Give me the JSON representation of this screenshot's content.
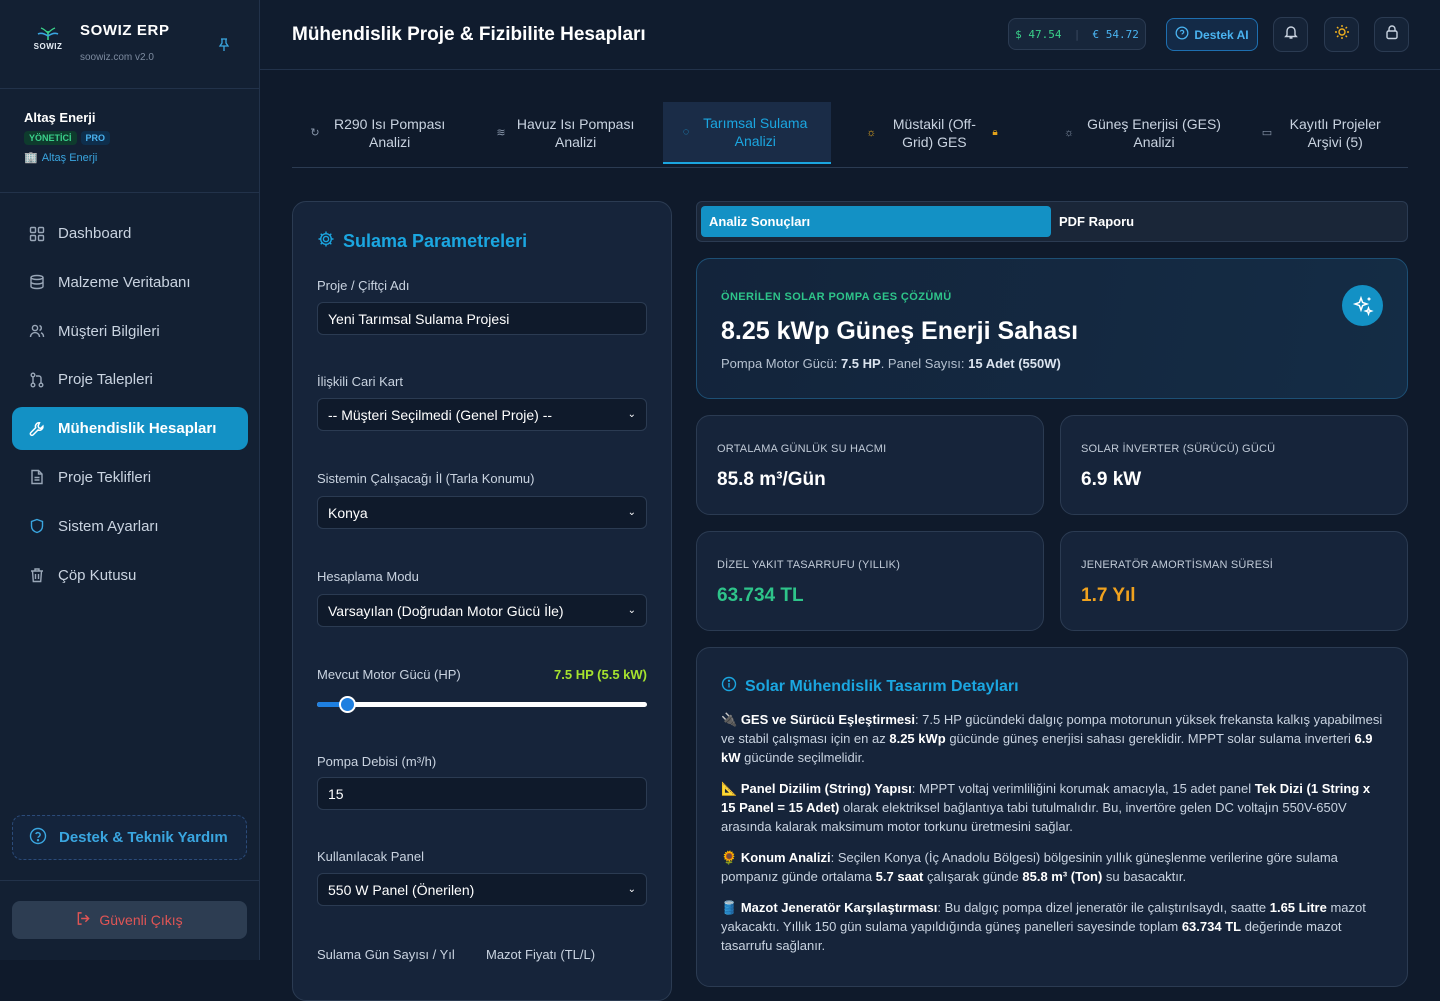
{
  "brand": {
    "title": "SOWIZ ERP",
    "subtitle": "soowiz.com v2.0",
    "logo_text": "SOWIZ"
  },
  "user": {
    "name": "Altaş Enerji",
    "badge_role": "YÖNETİCİ",
    "badge_plan": "PRO",
    "company": "Altaş Enerji"
  },
  "nav": [
    {
      "label": "Dashboard",
      "icon": "grid-icon",
      "active": false
    },
    {
      "label": "Malzeme Veritabanı",
      "icon": "database-icon",
      "active": false
    },
    {
      "label": "Müşteri Bilgileri",
      "icon": "users-icon",
      "active": false
    },
    {
      "label": "Proje Talepleri",
      "icon": "git-pull-icon",
      "active": false
    },
    {
      "label": "Mühendislik Hesapları",
      "icon": "wrench-icon",
      "active": true
    },
    {
      "label": "Proje Teklifleri",
      "icon": "document-icon",
      "active": false
    },
    {
      "label": "Sistem Ayarları",
      "icon": "shield-icon",
      "active": false
    },
    {
      "label": "Çöp Kutusu",
      "icon": "trash-icon",
      "active": false
    }
  ],
  "support": {
    "label": "Destek & Teknik Yardım"
  },
  "logout": {
    "label": "Güvenli Çıkış"
  },
  "header": {
    "title": "Mühendislik Proje & Fizibilite Hesapları",
    "usd": "$ 47.54",
    "eur": "€ 54.72",
    "ai_button": "Destek AI"
  },
  "tabs": [
    {
      "label": "R290 Isı Pompası Analizi",
      "icon": "refresh-icon",
      "active": false
    },
    {
      "label": "Havuz Isı Pompası Analizi",
      "icon": "waves-icon",
      "active": false
    },
    {
      "label": "Tarımsal Sulama Analizi",
      "icon": "droplet-icon",
      "active": true
    },
    {
      "label": "Müstakil (Off-Grid) GES",
      "icon": "sun-icon",
      "active": false,
      "locked": true
    },
    {
      "label": "Güneş Enerjisi (GES) Analizi",
      "icon": "sun-icon",
      "active": false
    },
    {
      "label": "Kayıtlı Projeler Arşivi (5)",
      "icon": "archive-icon",
      "active": false
    }
  ],
  "params": {
    "title": "Sulama Parametreleri",
    "project_name_label": "Proje / Çiftçi Adı",
    "project_name_value": "Yeni Tarımsal Sulama Projesi",
    "customer_label": "İlişkili Cari Kart",
    "customer_value": "-- Müşteri Seçilmedi (Genel Proje) --",
    "city_label": "Sistemin Çalışacağı İl (Tarla Konumu)",
    "city_value": "Konya",
    "mode_label": "Hesaplama Modu",
    "mode_value": "Varsayılan (Doğrudan Motor Gücü İle)",
    "motor_label": "Mevcut Motor Gücü (HP)",
    "motor_value": "7.5 HP (5.5 kW)",
    "motor_slider_fraction": 0.09,
    "flow_label": "Pompa Debisi (m³/h)",
    "flow_value": "15",
    "panel_label": "Kullanılacak Panel",
    "panel_value": "550 W Panel (Önerilen)",
    "days_label": "Sulama Gün Sayısı / Yıl",
    "diesel_label": "Mazot Fiyatı (TL/L)"
  },
  "results": {
    "tab_analysis": "Analiz Sonuçları",
    "tab_pdf": "PDF Raporu",
    "kicker": "ÖNERİLEN SOLAR POMPA GES ÇÖZÜMÜ",
    "headline": "8.25 kWp Güneş Enerji Sahası",
    "sub_motor_label": "Pompa Motor Gücü: ",
    "sub_motor_value": "7.5 HP",
    "sub_panel_label": ". Panel Sayısı: ",
    "sub_panel_value": "15 Adet (550W)",
    "stats": [
      {
        "label": "ORTALAMA GÜNLÜK SU HACMI",
        "value": "85.8 m³/Gün",
        "color": "#ffffff"
      },
      {
        "label": "SOLAR İNVERTER (SÜRÜCÜ) GÜCÜ",
        "value": "6.9 kW",
        "color": "#ffffff"
      },
      {
        "label": "DİZEL YAKIT TASARRUFU (YILLIK)",
        "value": "63.734 TL",
        "color": "#2ec48a"
      },
      {
        "label": "JENERATÖR AMORTİSMAN SÜRESİ",
        "value": "1.7 Yıl",
        "color": "#f0a21e"
      }
    ]
  },
  "details": {
    "title": "Solar Mühendislik Tasarım Detayları",
    "p1": {
      "emoji": "🔌",
      "title": "GES ve Sürücü Eşleştirmesi",
      "text_a": ": 7.5 HP gücündeki dalgıç pompa motorunun yüksek frekansta kalkış yapabilmesi ve stabil çalışması için en az ",
      "bold_a": "8.25 kWp",
      "text_b": " gücünde güneş enerjisi sahası gereklidir. MPPT solar sulama inverteri ",
      "bold_b": "6.9 kW",
      "text_c": " gücünde seçilmelidir."
    },
    "p2": {
      "emoji": "📐",
      "title": "Panel Dizilim (String) Yapısı",
      "text_a": ": MPPT voltaj verimliliğini korumak amacıyla, 15 adet panel ",
      "bold_a": "Tek Dizi (1 String x 15 Panel = 15 Adet)",
      "text_b": " olarak elektriksel bağlantıya tabi tutulmalıdır. Bu, invertöre gelen DC voltajın 550V-650V arasında kalarak maksimum motor torkunu üretmesini sağlar."
    },
    "p3": {
      "emoji": "🌻",
      "title": "Konum Analizi",
      "text_a": ": Seçilen Konya (İç Anadolu Bölgesi) bölgesinin yıllık güneşlenme verilerine göre sulama pompanız günde ortalama ",
      "bold_a": "5.7 saat",
      "text_b": " çalışarak günde ",
      "bold_b": "85.8 m³ (Ton)",
      "text_c": " su basacaktır."
    },
    "p4": {
      "emoji": "🛢️",
      "title": "Mazot Jeneratör Karşılaştırması",
      "text_a": ": Bu dalgıç pompa dizel jeneratör ile çalıştırılsaydı, saatte ",
      "bold_a": "1.65 Litre",
      "text_b": " mazot yakacaktı. Yıllık 150 gün sulama yapıldığında güneş panelleri sayesinde toplam ",
      "bold_b": "63.734 TL",
      "text_c": " değerinde mazot tasarrufu sağlanır."
    }
  }
}
